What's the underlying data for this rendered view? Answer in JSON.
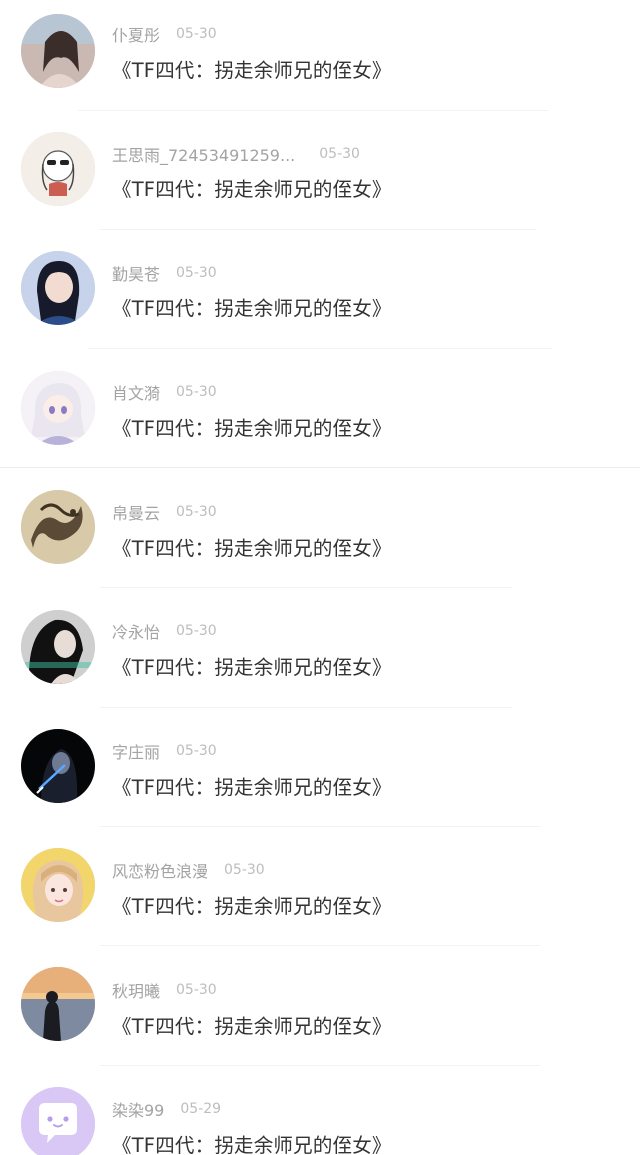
{
  "comments": [
    {
      "name": "仆夏彤",
      "date": "05-30",
      "message": "《TF四代：拐走余师兄的侄女》",
      "avatar": "girl-selfie"
    },
    {
      "name": "王思雨_72453491259...",
      "date": "05-30",
      "message": "《TF四代：拐走余师兄的侄女》",
      "avatar": "cartoon-sunglasses"
    },
    {
      "name": "勤昊苍",
      "date": "05-30",
      "message": "《TF四代：拐走余师兄的侄女》",
      "avatar": "girl-blue"
    },
    {
      "name": "肖文漪",
      "date": "05-30",
      "message": "《TF四代：拐走余师兄的侄女》",
      "avatar": "anime-girl"
    },
    {
      "name": "帛曼云",
      "date": "05-30",
      "message": "《TF四代：拐走余师兄的侄女》",
      "avatar": "dragon-painting"
    },
    {
      "name": "冷永怡",
      "date": "05-30",
      "message": "《TF四代：拐走余师兄的侄女》",
      "avatar": "dark-hair-girl"
    },
    {
      "name": "字庄丽",
      "date": "05-30",
      "message": "《TF四代：拐走余师兄的侄女》",
      "avatar": "dark-figure"
    },
    {
      "name": "风恋粉色浪漫",
      "date": "05-30",
      "message": "《TF四代：拐走余师兄的侄女》",
      "avatar": "blonde-girl"
    },
    {
      "name": "秋玥曦",
      "date": "05-30",
      "message": "《TF四代：拐走余师兄的侄女》",
      "avatar": "sunset-silhouette"
    },
    {
      "name": "染染99",
      "date": "05-29",
      "message": "《TF四代：拐走余师兄的侄女》",
      "avatar": "default-chat-bubble"
    }
  ],
  "colors": {
    "name": "#a3a3a3",
    "date": "#bdbdbd",
    "message": "#333333",
    "default_avatar": "#d9c8f5"
  }
}
